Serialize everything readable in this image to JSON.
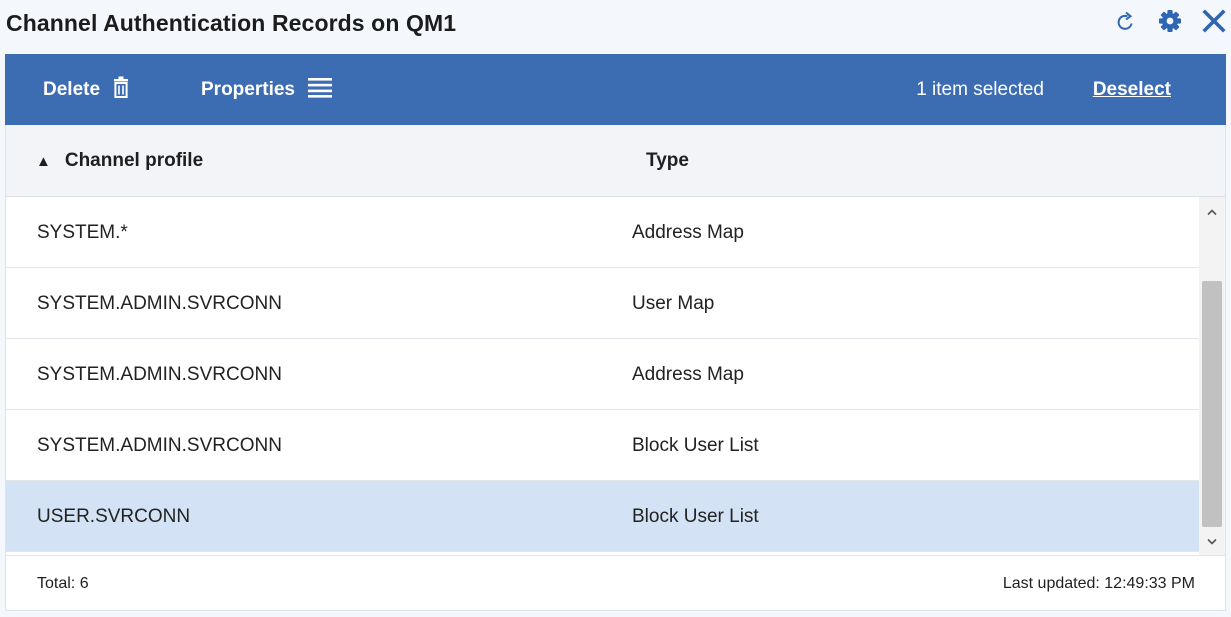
{
  "header": {
    "title": "Channel Authentication Records on QM1",
    "actions": [
      {
        "name": "refresh-icon"
      },
      {
        "name": "gear-icon"
      },
      {
        "name": "close-icon"
      }
    ]
  },
  "toolbar": {
    "delete_label": "Delete",
    "delete_icon": "trash-icon",
    "properties_label": "Properties",
    "properties_icon": "list-icon",
    "selection_text": "1 item selected",
    "deselect_label": "Deselect",
    "background": "#3c6db3"
  },
  "table": {
    "columns": [
      {
        "label": "Channel profile",
        "sort": "ascending"
      },
      {
        "label": "Type"
      }
    ],
    "rows": [
      {
        "profile": "SYSTEM.*",
        "type": "Address Map",
        "selected": false
      },
      {
        "profile": "SYSTEM.ADMIN.SVRCONN",
        "type": "User Map",
        "selected": false
      },
      {
        "profile": "SYSTEM.ADMIN.SVRCONN",
        "type": "Address Map",
        "selected": false
      },
      {
        "profile": "SYSTEM.ADMIN.SVRCONN",
        "type": "Block User List",
        "selected": false
      },
      {
        "profile": "USER.SVRCONN",
        "type": "Block User List",
        "selected": true
      }
    ],
    "selected_row_color": "#d3e3f5"
  },
  "footer": {
    "total": "Total: 6",
    "last_updated": "Last updated: 12:49:33 PM"
  }
}
